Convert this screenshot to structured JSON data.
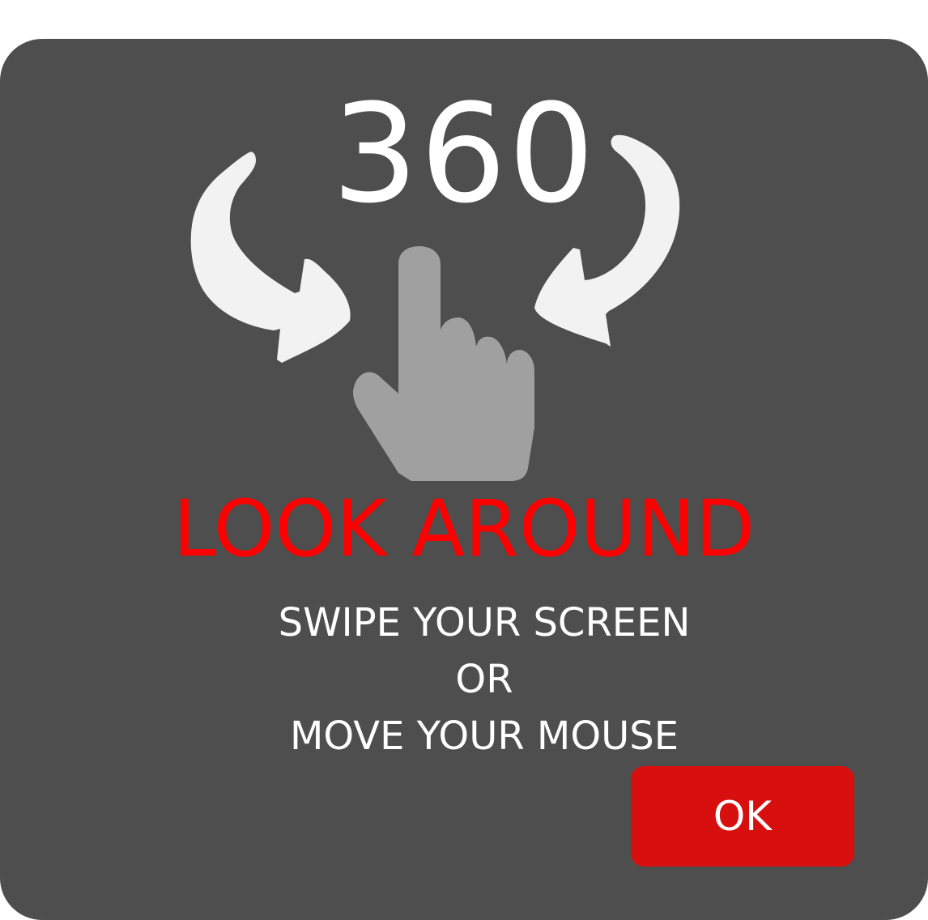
{
  "dialog": {
    "badge": "360",
    "headline": "LOOK AROUND",
    "instructions": {
      "line1": "SWIPE YOUR SCREEN",
      "line2": "OR",
      "line3": "MOVE YOUR MOUSE"
    },
    "ok_label": "OK"
  },
  "icons": {
    "left_arrow": "curved-arrow-icon",
    "right_arrow": "curved-arrow-icon",
    "hand": "pointing-hand-icon"
  },
  "colors": {
    "dialog_bg": "#4e4e4e",
    "headline": "#ff0000",
    "button": "#d80f0f",
    "hand": "#a0a0a0",
    "arrows": "#f2f2f2"
  }
}
